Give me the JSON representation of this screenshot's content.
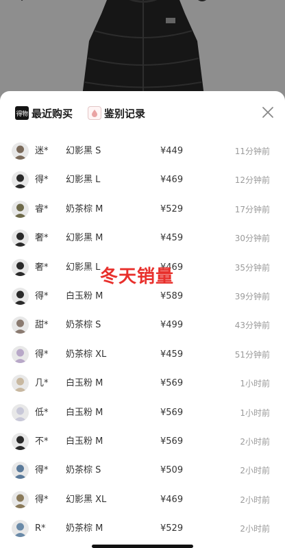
{
  "tabs": {
    "recent_icon_text": "得物",
    "recent_label": "最近购买",
    "appraisal_label": "鉴别记录"
  },
  "overlay_text": "冬天销量",
  "purchases": [
    {
      "buyer": "迷*",
      "variant": "幻影黑 S",
      "price": "¥449",
      "time": "11分钟前",
      "avatar_color": "#7a6a5a"
    },
    {
      "buyer": "得*",
      "variant": "幻影黑 L",
      "price": "¥469",
      "time": "12分钟前",
      "avatar_color": "#2a2a2a"
    },
    {
      "buyer": "睿*",
      "variant": "奶茶棕 M",
      "price": "¥529",
      "time": "17分钟前",
      "avatar_color": "#6e6a4a"
    },
    {
      "buyer": "奢*",
      "variant": "幻影黑 M",
      "price": "¥459",
      "time": "30分钟前",
      "avatar_color": "#2a2a2a"
    },
    {
      "buyer": "奢*",
      "variant": "幻影黑 L",
      "price": "¥469",
      "time": "35分钟前",
      "avatar_color": "#2a2a2a"
    },
    {
      "buyer": "得*",
      "variant": "白玉粉 M",
      "price": "¥589",
      "time": "39分钟前",
      "avatar_color": "#2a2a2a"
    },
    {
      "buyer": "甜*",
      "variant": "奶茶棕 S",
      "price": "¥499",
      "time": "43分钟前",
      "avatar_color": "#8a7a70"
    },
    {
      "buyer": "得*",
      "variant": "奶茶棕 XL",
      "price": "¥459",
      "time": "51分钟前",
      "avatar_color": "#b8a8c8"
    },
    {
      "buyer": "几*",
      "variant": "白玉粉 M",
      "price": "¥569",
      "time": "1小时前",
      "avatar_color": "#c8b8a0"
    },
    {
      "buyer": "低*",
      "variant": "白玉粉 M",
      "price": "¥569",
      "time": "1小时前",
      "avatar_color": "#c8c8d8"
    },
    {
      "buyer": "不*",
      "variant": "白玉粉 M",
      "price": "¥569",
      "time": "2小时前",
      "avatar_color": "#2a2a2a"
    },
    {
      "buyer": "得*",
      "variant": "奶茶棕 S",
      "price": "¥509",
      "time": "2小时前",
      "avatar_color": "#5a7a9a"
    },
    {
      "buyer": "得*",
      "variant": "幻影黑 XL",
      "price": "¥469",
      "time": "2小时前",
      "avatar_color": "#8a7a5a"
    },
    {
      "buyer": "R*",
      "variant": "奶茶棕 M",
      "price": "¥529",
      "time": "2小时前",
      "avatar_color": "#6a8aa8"
    }
  ],
  "icons": {
    "close": "close-icon",
    "recent": "dewu-logo-icon",
    "appraisal": "drop-icon"
  }
}
